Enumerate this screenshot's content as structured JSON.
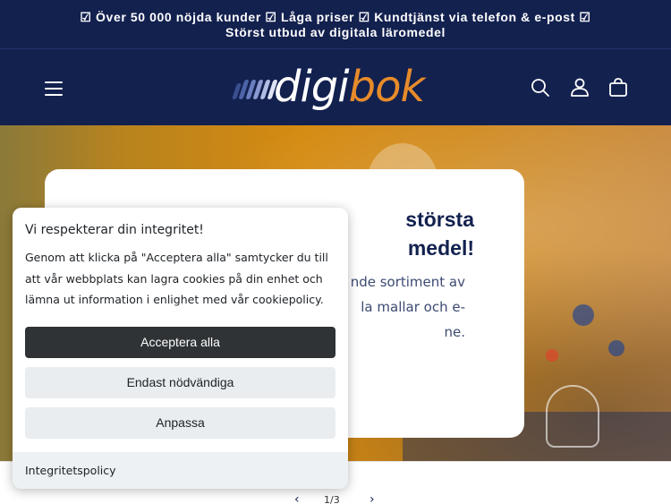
{
  "announcement": {
    "line1": "☑ Över 50 000 nöjda kunder   ☑ Låga priser   ☑ Kundtjänst via telefon & e-post   ☑",
    "line2": "Störst utbud av digitala läromedel"
  },
  "header": {
    "logo_part1": "digi",
    "logo_part2": "bok",
    "icons": [
      "menu-icon",
      "search-icon",
      "account-icon",
      "cart-icon"
    ]
  },
  "hero": {
    "title": "största\nmedel!",
    "text": "nde sortiment av\nla mallar och e-\nne."
  },
  "slider": {
    "prev": "‹",
    "counter": "1/3",
    "next": "›"
  },
  "consent": {
    "title": "Vi respekterar din integritet!",
    "body": "Genom att klicka på \"Acceptera alla\" samtycker du till att vår webbplats kan lagra cookies på din enhet och lämna ut information i enlighet med vår cookiepolicy.",
    "accept_all": "Acceptera alla",
    "necessary_only": "Endast nödvändiga",
    "customize": "Anpassa",
    "policy_link": "Integritetspolicy"
  },
  "colors": {
    "navy": "#13214f",
    "orange": "#e78b2a",
    "dark_button": "#2f3336",
    "light_button": "#e9edf0"
  }
}
